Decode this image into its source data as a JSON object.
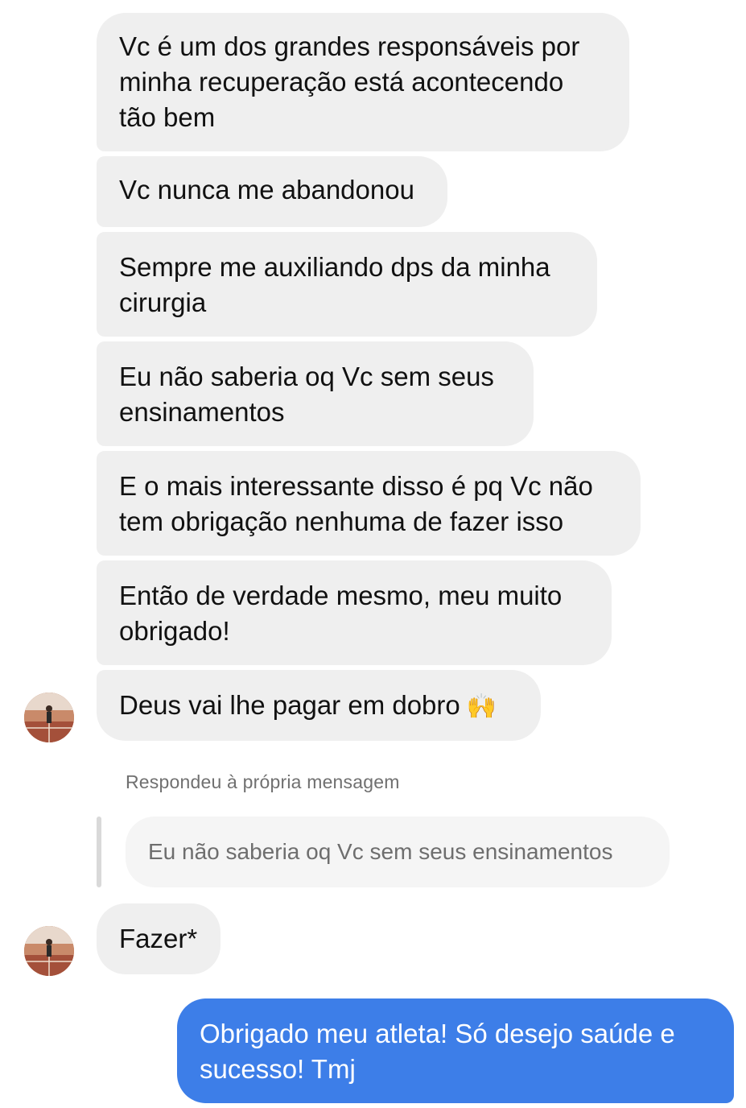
{
  "conversation": {
    "messages_in": [
      {
        "text": "Vc é um dos grandes responsáveis por minha recuperação está acontecendo tão bem"
      },
      {
        "text": "Vc nunca me abandonou"
      },
      {
        "text": "Sempre me auxiliando dps da minha cirurgia"
      },
      {
        "text": "Eu não saberia oq Vc sem seus ensinamentos"
      },
      {
        "text": "E o mais interessante disso é pq Vc não tem obrigação nenhuma de fazer isso"
      },
      {
        "text": "Então de verdade mesmo, meu muito obrigado!"
      },
      {
        "text": "Deus vai lhe pagar em dobro",
        "emoji": "🙌"
      }
    ],
    "reply": {
      "label": "Respondeu à própria mensagem",
      "quoted_text": "Eu não saberia oq Vc sem seus ensinamentos",
      "text": "Fazer*"
    },
    "message_out": {
      "text": "Obrigado  meu atleta! Só desejo saúde e sucesso! Tmj"
    }
  },
  "colors": {
    "incoming_bubble": "#efefef",
    "outgoing_bubble": "#3d7ee8",
    "meta_text": "#707070"
  },
  "icons": {
    "avatar": "contact-avatar-photo",
    "emoji": "raising-hands-emoji"
  }
}
